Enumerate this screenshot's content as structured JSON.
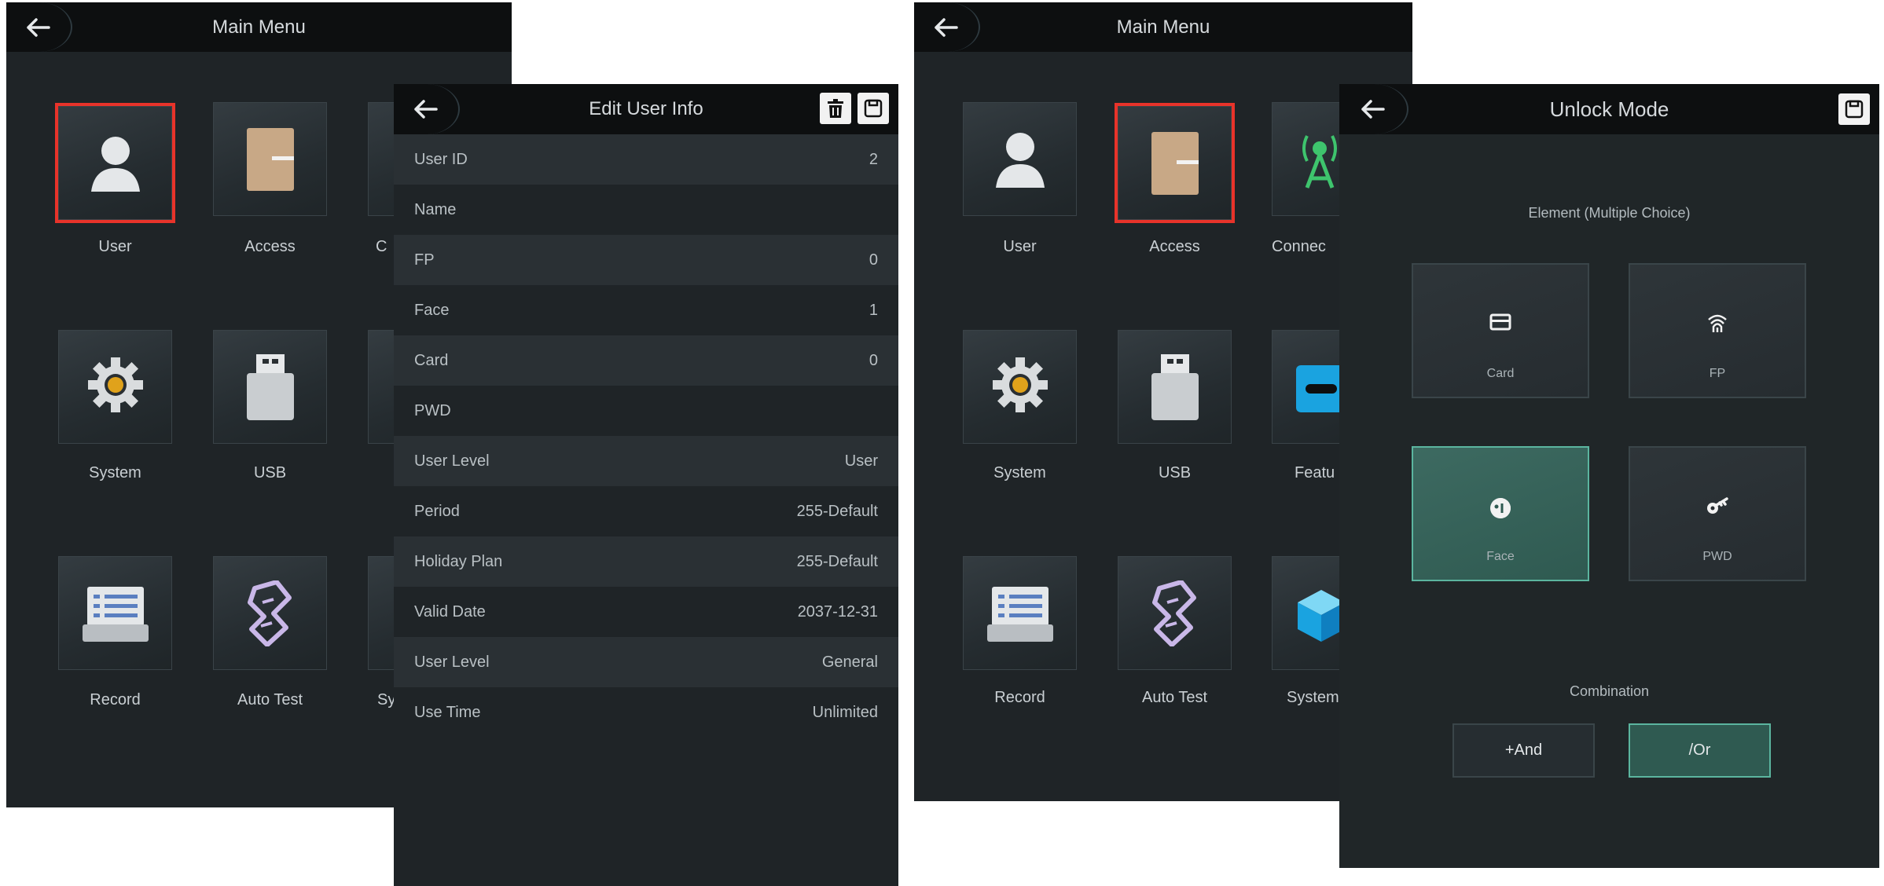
{
  "main_menu": {
    "title": "Main Menu",
    "items": [
      "User",
      "Access",
      "C",
      "System",
      "USB",
      "",
      "Record",
      "Auto Test",
      "Sy"
    ]
  },
  "edit_user": {
    "title": "Edit User Info",
    "rows": [
      {
        "label": "User ID",
        "value": "2"
      },
      {
        "label": "Name",
        "value": ""
      },
      {
        "label": "FP",
        "value": "0"
      },
      {
        "label": "Face",
        "value": "1"
      },
      {
        "label": "Card",
        "value": "0"
      },
      {
        "label": "PWD",
        "value": ""
      },
      {
        "label": "User Level",
        "value": "User"
      },
      {
        "label": "Period",
        "value": "255-Default"
      },
      {
        "label": "Holiday Plan",
        "value": "255-Default"
      },
      {
        "label": "Valid Date",
        "value": "2037-12-31"
      },
      {
        "label": "User Level",
        "value": "General"
      },
      {
        "label": "Use Time",
        "value": "Unlimited"
      }
    ]
  },
  "main_menu_2": {
    "title": "Main Menu",
    "items": [
      "User",
      "Access",
      "Connec",
      "System",
      "USB",
      "Featu",
      "Record",
      "Auto Test",
      "System"
    ]
  },
  "unlock_mode": {
    "title": "Unlock Mode",
    "element_heading": "Element (Multiple Choice)",
    "elements": [
      "Card",
      "FP",
      "Face",
      "PWD"
    ],
    "combination_heading": "Combination",
    "combinations": [
      "+And",
      "/Or"
    ]
  },
  "colors": {
    "selection": "#e8332a",
    "active_green": "#2f5a51"
  }
}
